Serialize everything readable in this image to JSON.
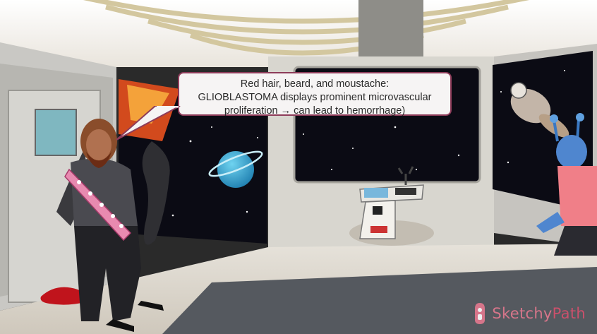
{
  "scene": {
    "speech_bubble": {
      "lines": [
        "Red hair, beard, and moustache:",
        "GLIOBLASTOMA displays prominent microvascular",
        "proliferation → can lead to hemorrhage)"
      ]
    },
    "watermark": {
      "part1": "Sketchy",
      "part2": "Path"
    }
  },
  "colors": {
    "bubble_border": "#8e3c5a",
    "brand": "#d9506d",
    "floor": "#dcd6cc",
    "space": "#0b0b14"
  }
}
